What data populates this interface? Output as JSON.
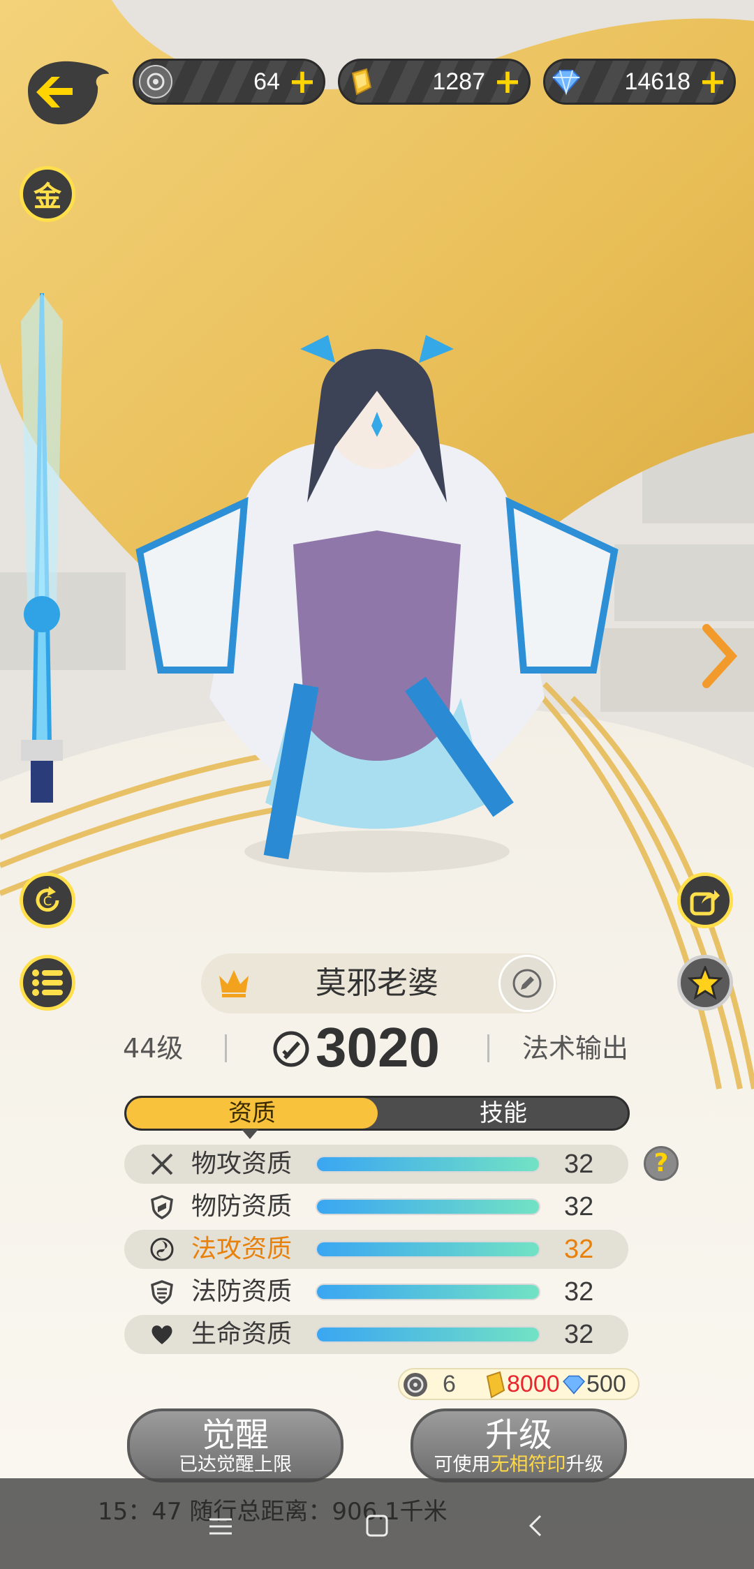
{
  "currency": {
    "tokens": {
      "value": "64",
      "icon": "token-coin-icon"
    },
    "gold": {
      "value": "1287",
      "icon": "gold-ingot-icon"
    },
    "gems": {
      "value": "14618",
      "icon": "diamond-icon"
    },
    "plus": "+"
  },
  "side_left": {
    "gold_badge": "金"
  },
  "character": {
    "name": "莫邪老婆",
    "level": "44级",
    "power": "3020",
    "role": "法术输出"
  },
  "tabs": [
    {
      "label": "资质",
      "active": true
    },
    {
      "label": "技能",
      "active": false
    }
  ],
  "attributes": [
    {
      "label": "物攻资质",
      "value": "32",
      "icon": "crossed-swords-icon",
      "fill": 1.0,
      "highlight": false
    },
    {
      "label": "物防资质",
      "value": "32",
      "icon": "shield-icon",
      "fill": 1.0,
      "highlight": false
    },
    {
      "label": "法攻资质",
      "value": "32",
      "icon": "magic-swirl-icon",
      "fill": 1.0,
      "highlight": true
    },
    {
      "label": "法防资质",
      "value": "32",
      "icon": "magic-shield-icon",
      "fill": 1.0,
      "highlight": false
    },
    {
      "label": "生命资质",
      "value": "32",
      "icon": "heart-icon",
      "fill": 1.0,
      "highlight": false
    }
  ],
  "help": "?",
  "cost": {
    "tokens": "6",
    "gold": "8000",
    "gems": "500"
  },
  "buttons": {
    "awaken": {
      "title": "觉醒",
      "sub": "已达觉醒上限"
    },
    "upgrade": {
      "title": "升级",
      "sub_prefix": "可使用",
      "sub_highlight": "无相符印",
      "sub_suffix": "升级"
    }
  },
  "status_bar": {
    "text": "15：47  随行总距离：906.1千米"
  },
  "colors": {
    "accent_yellow": "#f8c23d",
    "highlight_orange": "#e8800c",
    "cost_red": "#e8262f",
    "bar_blue": "#3aa6f2",
    "bar_green": "#72e2c4"
  }
}
